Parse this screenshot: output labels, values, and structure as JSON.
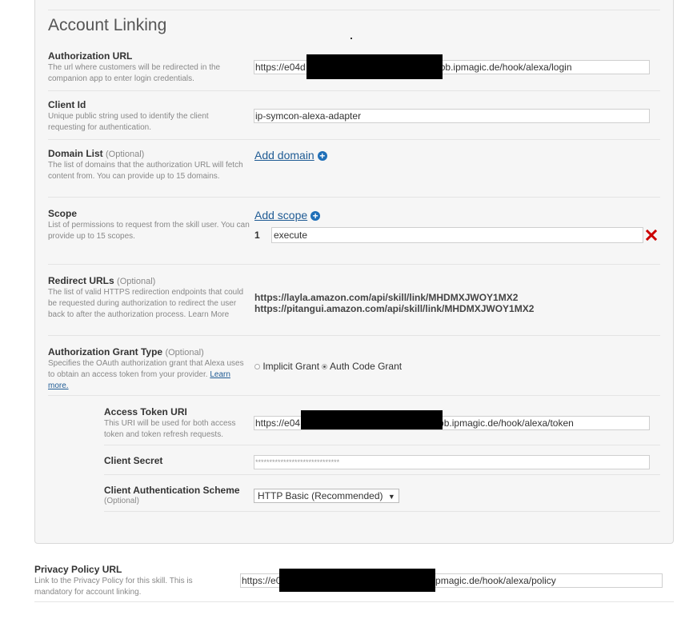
{
  "section_title": "Account Linking",
  "authorization_url": {
    "label": "Authorization URL",
    "description": "The url where customers will be redirected in the companion app to enter login credentials.",
    "value_prefix": "https://e04d",
    "value_suffix": "bb.ipmagic.de/hook/alexa/login"
  },
  "client_id": {
    "label": "Client Id",
    "description": "Unique public string used to identify the client requesting for authentication.",
    "value": "ip-symcon-alexa-adapter"
  },
  "domain_list": {
    "label": "Domain List",
    "optional": "(Optional)",
    "description": "The list of domains that the authorization URL will fetch content from. You can provide up to 15 domains.",
    "add_label": "Add domain"
  },
  "scope": {
    "label": "Scope",
    "description": "List of permissions to request from the skill user. You can provide up to 15 scopes.",
    "add_label": "Add scope",
    "items": [
      {
        "index": "1",
        "value": "execute"
      }
    ]
  },
  "redirect_urls": {
    "label": "Redirect URLs",
    "optional": "(Optional)",
    "description": "The list of valid HTTPS redirection endpoints that could be requested during authorization to redirect the user back to after the authorization process.",
    "learn_more": "Learn More",
    "urls": [
      "https://layla.amazon.com/api/skill/link/MHDMXJWOY1MX2",
      "https://pitangui.amazon.com/api/skill/link/MHDMXJWOY1MX2"
    ]
  },
  "grant_type": {
    "label": "Authorization Grant Type",
    "optional": "(Optional)",
    "description": "Specifies the OAuth authorization grant that Alexa uses to obtain an access token from your provider.",
    "learn_more": "Learn more.",
    "options": [
      "Implicit Grant",
      "Auth Code Grant"
    ],
    "selected": "Auth Code Grant"
  },
  "access_token_uri": {
    "label": "Access Token URI",
    "description": "This URI will be used for both access token and token refresh requests.",
    "value_prefix": "https://e04",
    "value_suffix": "bb.ipmagic.de/hook/alexa/token"
  },
  "client_secret": {
    "label": "Client Secret",
    "value": "******************************"
  },
  "client_auth_scheme": {
    "label": "Client Authentication Scheme",
    "optional": "(Optional)",
    "selected": "HTTP Basic (Recommended)"
  },
  "privacy_policy": {
    "label": "Privacy Policy URL",
    "description": "Link to the Privacy Policy for this skill. This is mandatory for account linking.",
    "value_prefix": "https://e0",
    "value_suffix": "b.ipmagic.de/hook/alexa/policy"
  },
  "colors": {
    "link": "#1f5b94",
    "plus_icon": "#1f6fb8",
    "delete_icon": "#cc0000",
    "panel_bg": "#f6f6f6"
  }
}
